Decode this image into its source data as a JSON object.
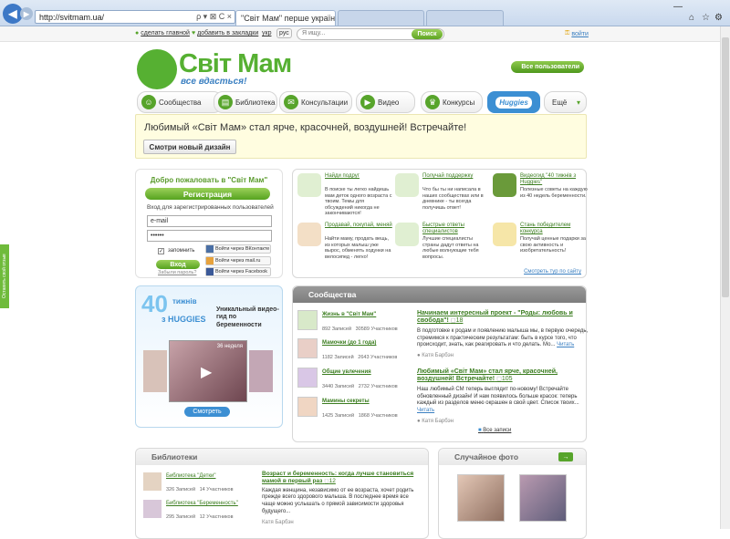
{
  "browser": {
    "url": "http://svitmam.ua/",
    "tab_active": "\"Світ Мам\" перше українське...",
    "tab_other": "",
    "search_glyphs": "ρ ▾ ⊠ C ×"
  },
  "topbar": {
    "home": "сделать главной",
    "bookmark": "добавить в закладки",
    "lang_ukr": "укр",
    "lang_rus": "рус",
    "search_placeholder": "Я ищу...",
    "search_btn": "Поиск",
    "login": "войти"
  },
  "logo": {
    "name": "Світ Мам",
    "slogan": "все вдасться!"
  },
  "all_users": "Все пользователи",
  "menu": [
    {
      "label": "Сообщества",
      "icon": "people-icon"
    },
    {
      "label": "Библиотека",
      "icon": "book-icon"
    },
    {
      "label": "Консультации",
      "icon": "chat-icon"
    },
    {
      "label": "Видео",
      "icon": "video-icon"
    },
    {
      "label": "Конкурсы",
      "icon": "trophy-icon"
    },
    {
      "label": "Ещё",
      "icon": "chevron-down-icon"
    }
  ],
  "huggies": "Huggies",
  "banner": {
    "text": "Любимый «Світ Мам» стал ярче, красочней, воздушней! Встречайте!",
    "button": "Смотри новый дизайн"
  },
  "login": {
    "title": "Добро пожаловать в \"Світ Мам\"",
    "register": "Регистрация",
    "subtitle": "Вход для зарегистрированных пользователей",
    "email": "e-mail",
    "password": "••••••",
    "remember": "запомнить",
    "enter": "Вход",
    "forgot": "Забыли пароль?",
    "vk": "Войти через ВКонтакте",
    "mailru": "Войти через mail.ru",
    "fb": "Войти через Facebook"
  },
  "features": [
    {
      "title": "Найди подруг",
      "text": "В поиске ты легко найдешь мам деток одного возраста с твоим. Темы для обсуждений никогда не закончиваются!"
    },
    {
      "title": "Получай поддержку",
      "text": "Что бы ты ни написала в наших сообществах или в дневнике - ты всегда получишь ответ!"
    },
    {
      "title": "Видеогид \"40 тижнів з Huggies\"",
      "text": "Полезные советы на каждую из 40 недель беременности."
    },
    {
      "title": "Продавай, покупай, меняй",
      "text": "Найти маму, продать вещь, из которых малыш уже вырос, обменять ходунки на велосипед - легко!"
    },
    {
      "title": "Быстрые ответы специалистов",
      "text": "Лучшие специалисты страны дадут ответы на любые волнующие тебя вопросы."
    },
    {
      "title": "Стань победителем конкурса",
      "text": "Получай ценные подарки за свою активность и изобретательность!"
    }
  ],
  "features_link": "Смотреть тур по сайту",
  "huggies_promo": {
    "num": "40",
    "word": "тижнів",
    "brand": "з HUGGIES",
    "title": "Уникальный видео-гид по беременности",
    "week": "36 неделя",
    "button": "Смотреть"
  },
  "communities": {
    "title": "Сообщества",
    "items": [
      {
        "name": "Жизнь в \"Світ Мам\"",
        "posts": "892",
        "posts_label": "Записей",
        "members": "30589",
        "members_label": "Участников"
      },
      {
        "name": "Мамочки (до 1 года)",
        "posts": "1182",
        "posts_label": "Записей",
        "members": "2643",
        "members_label": "Участников"
      },
      {
        "name": "Общие увлечения",
        "posts": "3440",
        "posts_label": "Записей",
        "members": "2732",
        "members_label": "Участников"
      },
      {
        "name": "Мамины секреты",
        "posts": "1425",
        "posts_label": "Записей",
        "members": "1868",
        "members_label": "Участников"
      }
    ],
    "posts": [
      {
        "title": "Начинаем интересный проект - \"Роды: любовь и свобода\"!",
        "comments": "18",
        "text": "В подготовке к родам и появлению малыша мы, в первую очередь, стремимся к практическим результатам: быть в курсе того, что происходит, знать, как реагировать и что делать. Мо...",
        "more": "Читать",
        "author": "Катя Барбэн"
      },
      {
        "title": "Любимый «Світ Мам» стал ярче, красочней, воздушней! Встречайте!",
        "comments": "105",
        "text": "Наш любимый СМ теперь выглядит по-новому! Встречайте обновленный дизайн! И нам появилось больше красок: теперь каждый из разделов меню окрашен в свой цвет. Список твоих...",
        "more": "Читать",
        "author": "Катя Барбэн"
      }
    ],
    "all": "Все записи"
  },
  "library": {
    "title": "Библиотеки",
    "items": [
      {
        "name": "Библиотека \"Детки\"",
        "posts": "326",
        "posts_label": "Записей",
        "members": "14",
        "members_label": "Участников"
      },
      {
        "name": "Библиотека \"Беременность\"",
        "posts": "295",
        "posts_label": "Записей",
        "members": "12",
        "members_label": "Участников"
      }
    ],
    "post": {
      "title": "Возраст и беременность: когда лучше становиться мамой в первый раз",
      "comments": "12",
      "text": "Каждая женщина, независимо от ее возраста, хочет родить прежде всего здорового малыша. В последнее время все чаще можно услышать о прямой зависимости здоровья будущего...",
      "author": "Катя Барбэн"
    }
  },
  "random_photo": {
    "title": "Случайное фото"
  },
  "feedback": "Оставить свой отзыв",
  "colors": {
    "green": "#56b032",
    "blue": "#3c8fd3",
    "banner": "#fffde0"
  }
}
